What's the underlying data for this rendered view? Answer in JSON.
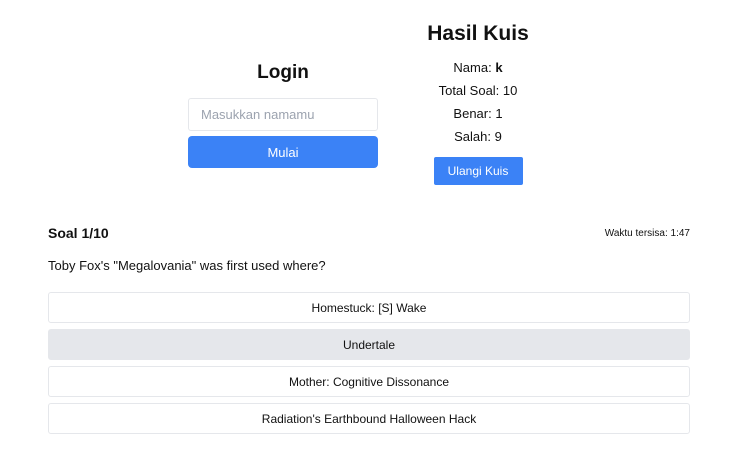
{
  "login": {
    "title": "Login",
    "name_placeholder": "Masukkan namamu",
    "name_value": "",
    "start_label": "Mulai"
  },
  "result": {
    "title": "Hasil Kuis",
    "name_label": "Nama: ",
    "name_value": "k",
    "total_label": "Total Soal: ",
    "total_value": "10",
    "correct_label": "Benar: ",
    "correct_value": "1",
    "wrong_label": "Salah: ",
    "wrong_value": "9",
    "retry_label": "Ulangi Kuis"
  },
  "quiz": {
    "counter": "Soal 1/10",
    "timer": "Waktu tersisa: 1:47",
    "question": "Toby Fox's \"Megalovania\" was first used where?",
    "options": [
      "Homestuck: [S] Wake",
      "Undertale",
      "Mother: Cognitive Dissonance",
      "Radiation's Earthbound Halloween Hack"
    ]
  },
  "colors": {
    "accent": "#3b82f6",
    "option_hover": "#e5e7eb",
    "border": "#e5e7eb"
  }
}
